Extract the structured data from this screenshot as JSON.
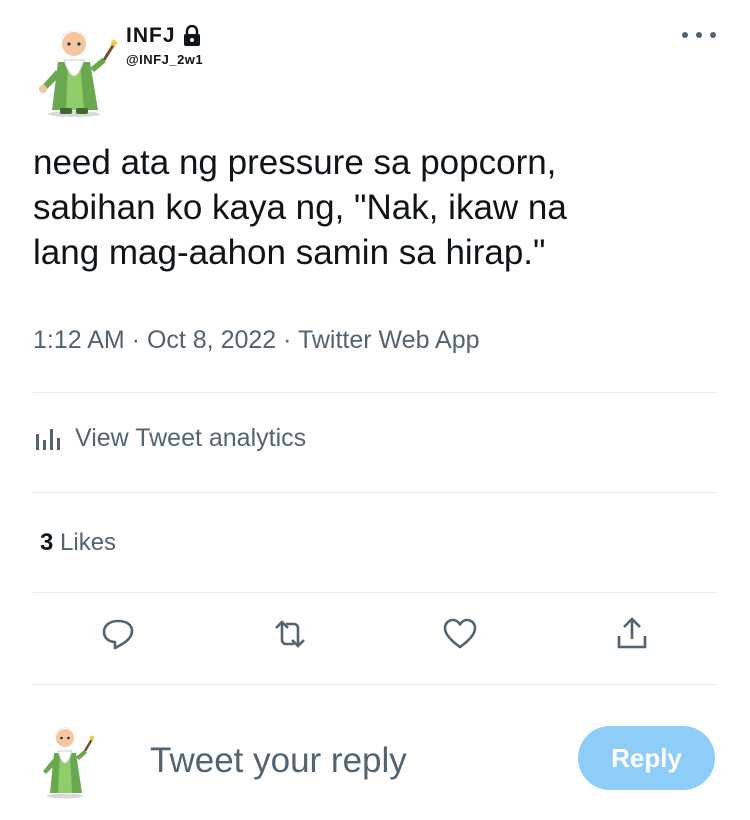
{
  "author": {
    "display_name": "INFJ",
    "handle": "@INFJ_2w1",
    "avatar_icon": "wizard-avatar-icon",
    "protected_icon": "lock-icon"
  },
  "tweet": {
    "text_lines": [
      "need ata ng pressure sa popcorn,",
      "sabihan ko kaya ng, \"Nak, ikaw na",
      "lang mag-aahon samin sa hirap.\""
    ],
    "meta": "1:12 AM · Oct 8, 2022 · Twitter Web App"
  },
  "analytics": {
    "label": "View Tweet analytics",
    "icon": "bar-chart-icon"
  },
  "stats": {
    "likes_count": "3",
    "likes_label": " Likes"
  },
  "actions": {
    "reply_icon": "reply-icon",
    "retweet_icon": "retweet-icon",
    "like_icon": "heart-icon",
    "share_icon": "share-icon"
  },
  "reply_box": {
    "placeholder": "Tweet your reply",
    "button_label": "Reply"
  },
  "colors": {
    "text_primary": "#0f1419",
    "text_secondary": "#536471",
    "divider": "#e6ecf0",
    "reply_button_disabled": "#8ecdf7"
  }
}
